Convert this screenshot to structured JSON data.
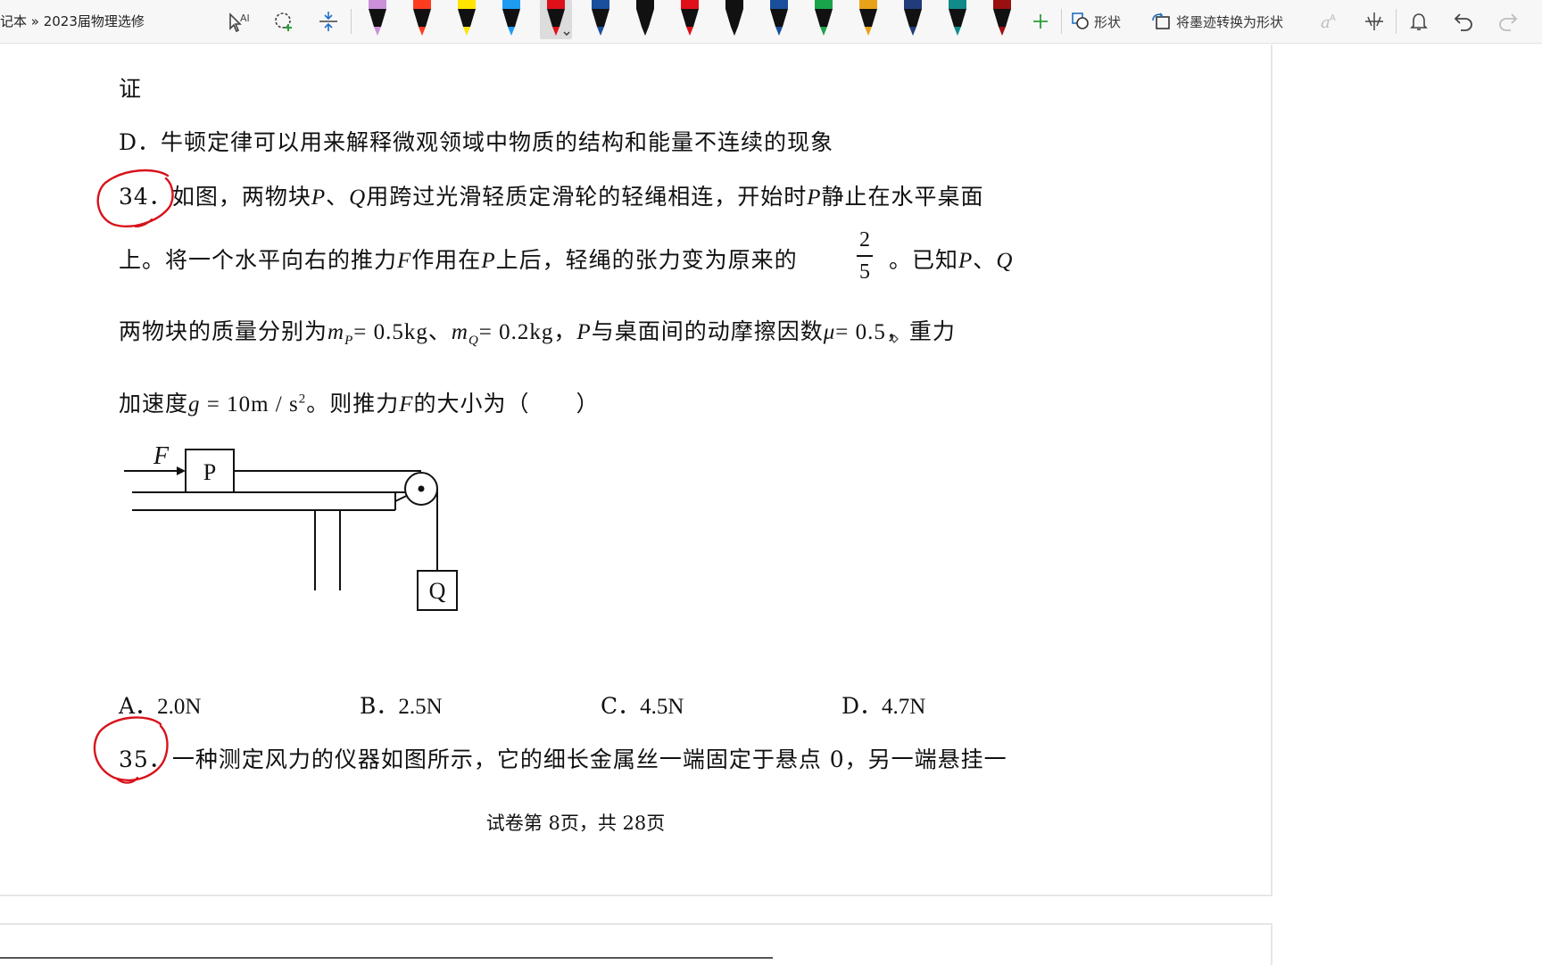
{
  "toolbar": {
    "breadcrumb": "记本 » 2023届物理选修",
    "shapes_label": "形状",
    "convert_label": "将墨迹转换为形状",
    "pens": [
      {
        "color": "#cc8fd9"
      },
      {
        "color": "#ff3b1f"
      },
      {
        "color": "#ffe500"
      },
      {
        "color": "#1f9cf0"
      },
      {
        "color": "#e0101a",
        "selected": true
      },
      {
        "color": "#1a4f9e"
      },
      {
        "color": "#111111"
      },
      {
        "color": "#e0101a"
      },
      {
        "color": "#111111"
      },
      {
        "color": "#1a4f9e"
      },
      {
        "color": "#1aa34a"
      },
      {
        "color": "#e8a21a"
      },
      {
        "color": "#203c7a"
      },
      {
        "color": "#118a8a"
      },
      {
        "color": "#9a1010"
      }
    ]
  },
  "document": {
    "line_prev": "证",
    "option_d_prev": "D．牛顿定律可以用来解释微观领域中物质的结构和能量不连续的现象",
    "q34": {
      "number": "34．",
      "line1": "如图，两物块",
      "P": "P",
      "sep": "、",
      "Q": "Q",
      "line1b": "用跨过光滑轻质定滑轮的轻绳相连，开始时",
      "line1c": "静止在水平桌面",
      "line2a": "上。将一个水平向右的推力",
      "F": "F",
      "line2b": "作用在",
      "line2c": "上后，轻绳的张力变为原来的",
      "frac_num": "2",
      "frac_den": "5",
      "line2d": "。已知",
      "line3a": "两物块的质量分别为",
      "mp": "= 0.5kg",
      "line3b": "、",
      "mq": "= 0.2kg",
      "line3c": "，",
      "line3d": "与桌面间的动摩擦因数",
      "mu": "= 0.5",
      "line3e": "，重力",
      "line4a": "加速度",
      "g": "= 10m / s",
      "line4b": "。则推力",
      "line4c": "的大小为（　　）",
      "options": [
        {
          "label": "A．",
          "value": "2.0N"
        },
        {
          "label": "B．",
          "value": "2.5N"
        },
        {
          "label": "C．",
          "value": "4.5N"
        },
        {
          "label": "D．",
          "value": "4.7N"
        }
      ]
    },
    "figure": {
      "block_p": "P",
      "block_q": "Q",
      "force": "F"
    },
    "q35": {
      "number": "35．",
      "text": "一种测定风力的仪器如图所示，它的细长金属丝一端固定于悬点 0，另一端悬挂一"
    },
    "footer": "试卷第 8页，共 28页"
  },
  "colors": {
    "ink_red": "#d8121b",
    "toolbar_bg": "#f7f7f7"
  }
}
